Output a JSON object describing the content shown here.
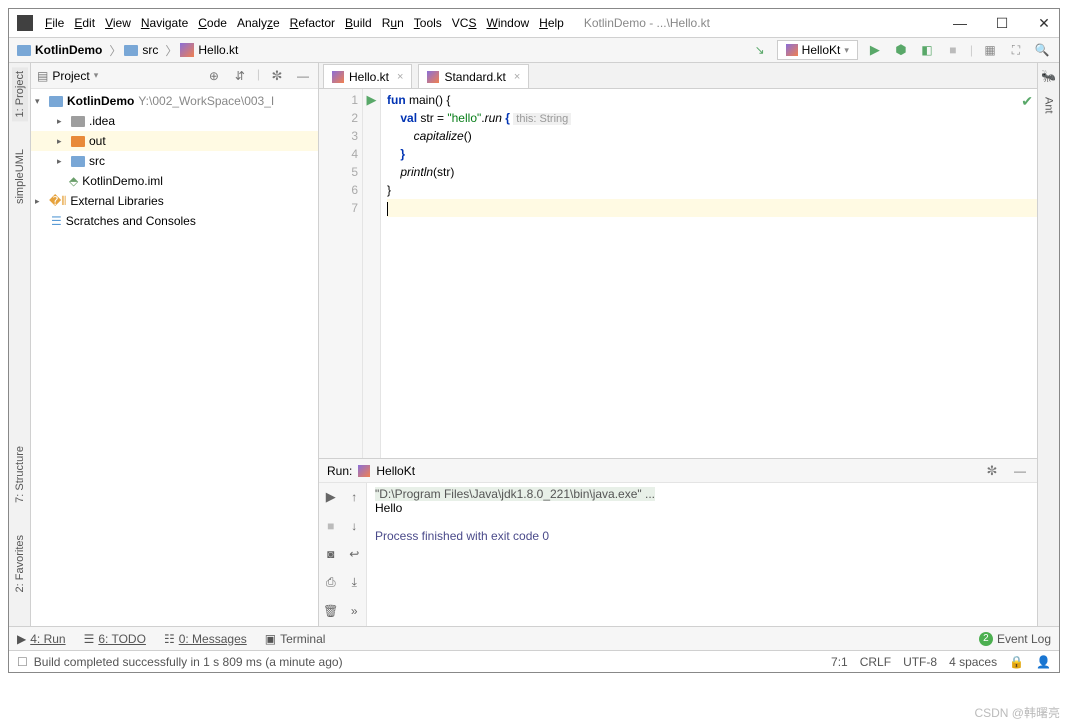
{
  "window": {
    "title": "KotlinDemo - ...\\Hello.kt"
  },
  "menu": [
    "File",
    "Edit",
    "View",
    "Navigate",
    "Code",
    "Analyze",
    "Refactor",
    "Build",
    "Run",
    "Tools",
    "VCS",
    "Window",
    "Help"
  ],
  "breadcrumbs": [
    "KotlinDemo",
    "src",
    "Hello.kt"
  ],
  "run_config": {
    "label": "HelloKt"
  },
  "project_panel": {
    "title": "Project",
    "root": {
      "name": "KotlinDemo",
      "path": "Y:\\002_WorkSpace\\003_I"
    },
    "items": [
      {
        "name": ".idea",
        "depth": 1,
        "kind": "folder-dark"
      },
      {
        "name": "out",
        "depth": 1,
        "kind": "folder-orange",
        "sel": true
      },
      {
        "name": "src",
        "depth": 1,
        "kind": "folder-blue"
      },
      {
        "name": "KotlinDemo.iml",
        "depth": 1,
        "kind": "file"
      }
    ],
    "external": "External Libraries",
    "scratches": "Scratches and Consoles"
  },
  "tabs": [
    {
      "label": "Hello.kt",
      "active": true
    },
    {
      "label": "Standard.kt",
      "active": false
    }
  ],
  "code": {
    "lines": [
      {
        "n": 1,
        "run": true,
        "html": "<span class='kw'>fun</span> main() {"
      },
      {
        "n": 2,
        "html": "    <span class='kw'>val</span> str = <span class='str'>\"hello\"</span>.<span class='fn'>run</span> <span class='kw'>{</span> <span class='hint'>this: String</span>"
      },
      {
        "n": 3,
        "html": "        <span class='fn'>capitalize</span>()"
      },
      {
        "n": 4,
        "html": "    <span class='kw'>}</span>"
      },
      {
        "n": 5,
        "html": "    <span class='fn'>println</span>(str)"
      },
      {
        "n": 6,
        "html": "}"
      },
      {
        "n": 7,
        "html": "<span class='cursor'></span>",
        "cursor": true
      }
    ]
  },
  "run_panel": {
    "title": "Run:",
    "config": "HelloKt",
    "cmd": "\"D:\\Program Files\\Java\\jdk1.8.0_221\\bin\\java.exe\" ...",
    "output": "Hello",
    "exit": "Process finished with exit code 0"
  },
  "bottom_tabs": {
    "run": "4: Run",
    "todo": "6: TODO",
    "messages": "0: Messages",
    "terminal": "Terminal",
    "event_log": "Event Log",
    "event_count": "2"
  },
  "status": {
    "msg": "Build completed successfully in 1 s 809 ms (a minute ago)",
    "pos": "7:1",
    "eol": "CRLF",
    "enc": "UTF-8",
    "indent": "4 spaces"
  },
  "left_tabs": [
    "1: Project",
    "simpleUML"
  ],
  "left_tabs2": [
    "7: Structure",
    "2: Favorites"
  ],
  "right_tabs": [
    "Ant"
  ],
  "watermark": "CSDN @韩曙亮"
}
